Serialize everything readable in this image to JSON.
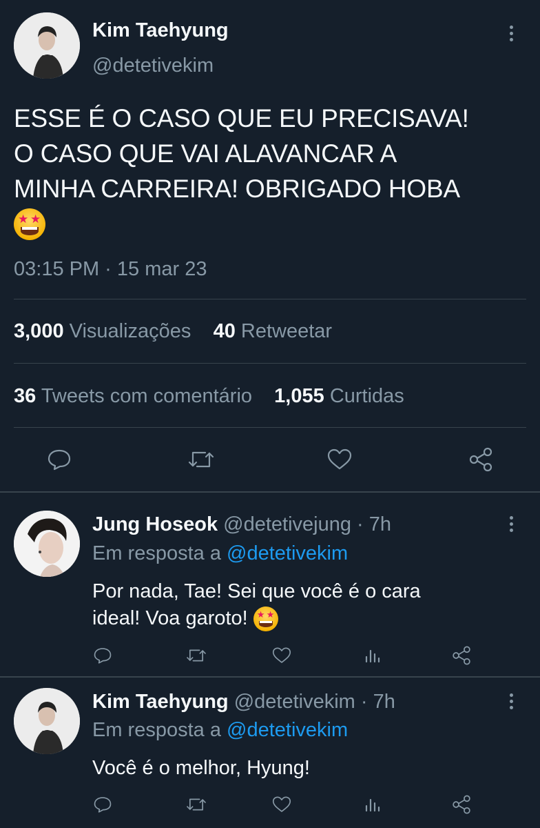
{
  "main_tweet": {
    "author_name": "Kim Taehyung",
    "author_handle": "@detetivekim",
    "text_lines": [
      "ESSE É O CASO QUE EU PRECISAVA!",
      "O CASO QUE VAI ALAVANCAR A",
      "MINHA CARREIRA! OBRIGADO HOBA"
    ],
    "emoji": "star-struck",
    "timestamp": "03:15 PM · 15 mar 23",
    "stats": {
      "views_count": "3,000",
      "views_label": "Visualizações",
      "retweets_count": "40",
      "retweets_label": "Retweetar",
      "quotes_count": "36",
      "quotes_label": "Tweets com comentário",
      "likes_count": "1,055",
      "likes_label": "Curtidas"
    },
    "actions": [
      "reply-icon",
      "retweet-icon",
      "like-icon",
      "share-icon"
    ]
  },
  "replies": [
    {
      "author_name": "Jung Hoseok",
      "handle_time": "@detetivejung · 7h",
      "reply_prefix": "Em resposta a",
      "reply_to": "@detetivekim",
      "text_lines": [
        "Por nada, Tae! Sei que você é o cara",
        "ideal! Voa garoto!"
      ],
      "emoji": "star-struck"
    },
    {
      "author_name": "Kim Taehyung",
      "handle_time": "@detetivekim · 7h",
      "reply_prefix": "Em resposta a",
      "reply_to": "@detetivekim",
      "text_lines": [
        "Você é o melhor, Hyung!"
      ]
    }
  ],
  "reply_actions": [
    "reply-icon",
    "retweet-icon",
    "like-icon",
    "analytics-icon",
    "share-icon"
  ],
  "colors": {
    "background": "#151f2b",
    "text": "#f5f8fa",
    "muted": "#8899a6",
    "link": "#1d9bf0",
    "divider": "#38444d"
  }
}
